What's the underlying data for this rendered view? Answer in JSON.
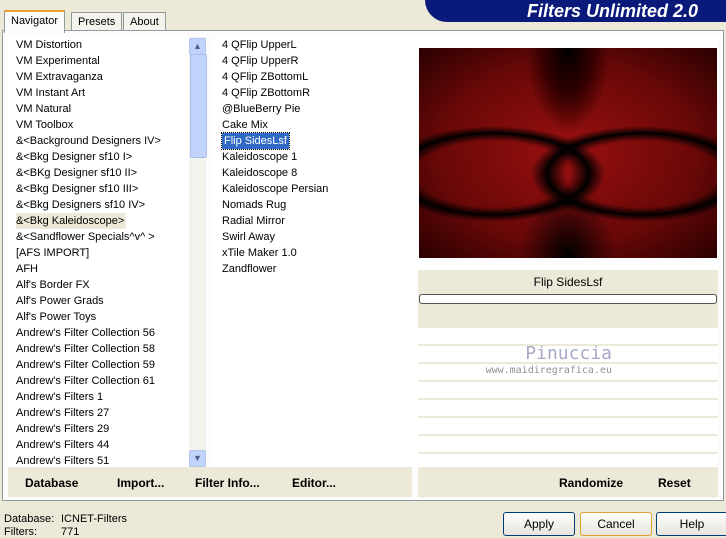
{
  "app_title": "Filters Unlimited 2.0",
  "tabs": [
    {
      "label": "Navigator",
      "active": true
    },
    {
      "label": "Presets"
    },
    {
      "label": "About"
    }
  ],
  "categories": [
    "VM Distortion",
    "VM Experimental",
    "VM Extravaganza",
    "VM Instant Art",
    "VM Natural",
    "VM Toolbox",
    "&<Background Designers IV>",
    "&<Bkg Designer sf10 I>",
    "&<BKg Designer sf10 II>",
    "&<Bkg Designer sf10 III>",
    "&<Bkg Designers sf10 IV>",
    "&<Bkg Kaleidoscope>",
    "&<Sandflower Specials^v^ >",
    "[AFS IMPORT]",
    "AFH",
    "Alf's Border FX",
    "Alf's Power Grads",
    "Alf's Power Toys",
    "Andrew's Filter Collection 56",
    "Andrew's Filter Collection 58",
    "Andrew's Filter Collection 59",
    "Andrew's Filter Collection 61",
    "Andrew's Filters 1",
    "Andrew's Filters 27",
    "Andrew's Filters 29",
    "Andrew's Filters 44",
    "Andrew's Filters 51"
  ],
  "selected_category": "&<Bkg Kaleidoscope>",
  "filters": [
    "4 QFlip UpperL",
    "4 QFlip UpperR",
    "4 QFlip ZBottomL",
    "4 QFlip ZBottomR",
    "@BlueBerry Pie",
    "Cake Mix",
    "Flip SidesLsf",
    "Kaleidoscope 1",
    "Kaleidoscope 8",
    "Kaleidoscope Persian",
    "Nomads Rug",
    "Radial Mirror",
    "Swirl Away",
    "xTile Maker 1.0",
    "Zandflower"
  ],
  "selected_filter": "Flip SidesLsf",
  "preview_filter_name": "Flip SidesLsf",
  "progress": 0,
  "watermark": {
    "name": "Pinuccia",
    "url": "www.maidiregrafica.eu"
  },
  "bottom_buttons": {
    "database": "Database",
    "import": "Import...",
    "filter_info": "Filter Info...",
    "editor": "Editor...",
    "randomize": "Randomize",
    "reset": "Reset"
  },
  "status": {
    "database_label": "Database:",
    "database_value": "ICNET-Filters",
    "filters_label": "Filters:",
    "filters_value": "771"
  },
  "dialog_buttons": {
    "apply": "Apply",
    "cancel": "Cancel",
    "help": "Help"
  },
  "colors": {
    "banner": "#0a1a7a",
    "selection": "#316ac5"
  }
}
